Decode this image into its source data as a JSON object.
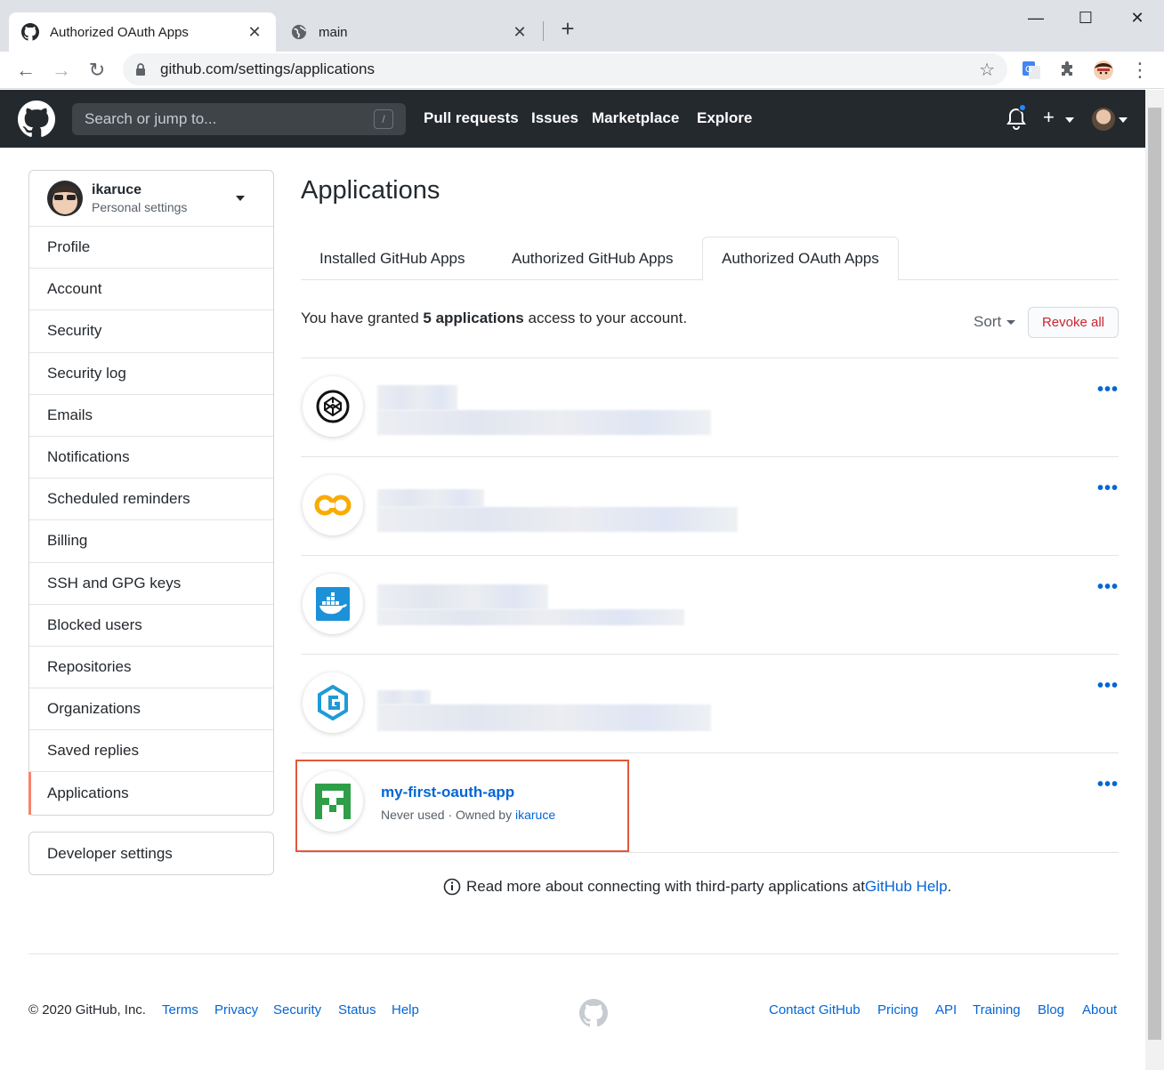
{
  "browser": {
    "tabs": [
      {
        "title": "Authorized OAuth Apps",
        "icon": "github-icon",
        "active": true
      },
      {
        "title": "main",
        "icon": "globe-icon",
        "active": false
      }
    ],
    "close_glyph": "✕",
    "new_tab_glyph": "+",
    "window": {
      "minimize": "—",
      "maximize": "☐",
      "close": "✕"
    },
    "url": "github.com/settings/applications",
    "back_glyph": "←",
    "forward_glyph": "→",
    "reload_glyph": "↻",
    "star_glyph": "☆",
    "menu_glyph": "⋮"
  },
  "header": {
    "search_placeholder": "Search or jump to...",
    "search_shortcut": "/",
    "nav": [
      "Pull requests",
      "Issues",
      "Marketplace",
      "Explore"
    ],
    "plus_glyph": "+"
  },
  "sidebar": {
    "username": "ikaruce",
    "subtitle": "Personal settings",
    "items": [
      {
        "label": "Profile"
      },
      {
        "label": "Account"
      },
      {
        "label": "Security"
      },
      {
        "label": "Security log"
      },
      {
        "label": "Emails"
      },
      {
        "label": "Notifications"
      },
      {
        "label": "Scheduled reminders"
      },
      {
        "label": "Billing"
      },
      {
        "label": "SSH and GPG keys"
      },
      {
        "label": "Blocked users"
      },
      {
        "label": "Repositories"
      },
      {
        "label": "Organizations"
      },
      {
        "label": "Saved replies"
      },
      {
        "label": "Applications"
      }
    ],
    "selected": "Applications",
    "developer_settings": "Developer settings"
  },
  "main": {
    "title": "Applications",
    "tabs": [
      {
        "label": "Installed GitHub Apps"
      },
      {
        "label": "Authorized GitHub Apps"
      },
      {
        "label": "Authorized OAuth Apps"
      }
    ],
    "selected_tab": "Authorized OAuth Apps",
    "granted_prefix": "You have granted ",
    "granted_count": "5 applications",
    "granted_suffix": " access to your account.",
    "sort_label": "Sort",
    "revoke_all_label": "Revoke all",
    "more_glyph": "•••",
    "apps": [
      {
        "logo": "codepen-icon",
        "blurred": true
      },
      {
        "logo": "colab-icon",
        "blurred": true
      },
      {
        "logo": "docker-icon",
        "blurred": true
      },
      {
        "logo": "gitkraken-icon",
        "blurred": true
      },
      {
        "logo": "identicon-icon",
        "name": "my-first-oauth-app",
        "status": "Never used",
        "separator": " · ",
        "owned_by": "Owned by ",
        "owner": "ikaruce"
      }
    ],
    "info_prefix": "Read more about connecting with third-party applications at ",
    "info_link": "GitHub Help",
    "info_suffix": "."
  },
  "footer": {
    "copyright": "© 2020 GitHub, Inc.",
    "left_links": [
      "Terms",
      "Privacy",
      "Security",
      "Status",
      "Help"
    ],
    "right_links": [
      "Contact GitHub",
      "Pricing",
      "API",
      "Training",
      "Blog",
      "About"
    ]
  },
  "colors": {
    "header_bg": "#24292e",
    "link": "#0366d6",
    "danger": "#cb2431",
    "selected_accent": "#f9826c",
    "highlight_border": "#e0583a"
  }
}
